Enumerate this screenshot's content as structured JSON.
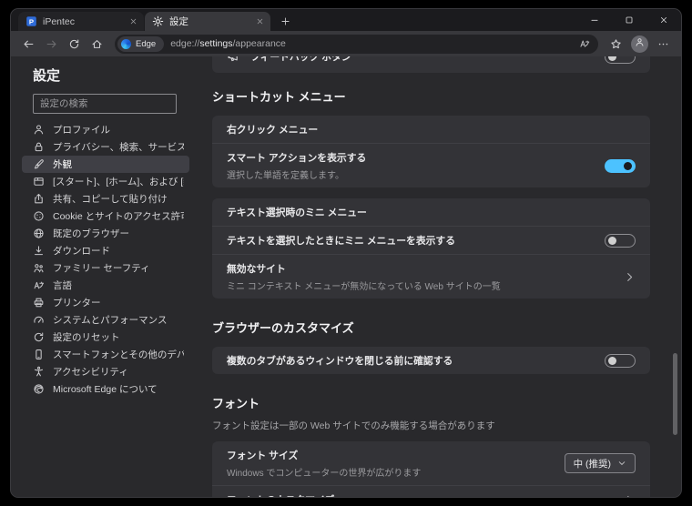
{
  "icons": {
    "back": "left-arrow",
    "forward": "right-arrow",
    "refresh": "circular-arrow",
    "home": "house",
    "translate": "translate-a",
    "star": "favorites-star",
    "ellipsis": "three-dots-menu",
    "person": "user-silhouette",
    "privacy": "padlock",
    "appearance": "paint-brush",
    "tabs": "browser-tabs",
    "share": "share-arrow",
    "cookie": "cookie",
    "globe": "globe",
    "download": "download-arrow",
    "family": "two-people",
    "language": "letter-a-kana",
    "printer": "printer",
    "performance": "speedometer",
    "reset": "circular-arrow",
    "phone": "smartphone",
    "accessibility": "accessibility-person",
    "edge": "edge-swirl",
    "feedback": "megaphone",
    "gear": "gear",
    "plus": "plus",
    "close": "x-cross",
    "minimize": "line",
    "maximize": "square",
    "chevdown": "chevron-down",
    "chevright": "chevron-right",
    "ipentec": "ipentec-logo"
  },
  "window": {
    "tabs": [
      {
        "title": "iPentec",
        "icon": "ipentec",
        "active": false
      },
      {
        "title": "設定",
        "icon": "gear",
        "active": true
      }
    ]
  },
  "navbar": {
    "badge": "Edge",
    "url_scheme": "edge://",
    "url_host": "settings",
    "url_path": "/appearance"
  },
  "sidebar": {
    "title": "設定",
    "search_placeholder": "設定の検索",
    "items": [
      {
        "label": "プロファイル",
        "icon": "person",
        "selected": false
      },
      {
        "label": "プライバシー、検索、サービス",
        "icon": "privacy",
        "selected": false
      },
      {
        "label": "外観",
        "icon": "appearance",
        "selected": true
      },
      {
        "label": "[スタート]、[ホーム]、および [新規] タブ",
        "icon": "tabs",
        "selected": false
      },
      {
        "label": "共有、コピーして貼り付け",
        "icon": "share",
        "selected": false
      },
      {
        "label": "Cookie とサイトのアクセス許可",
        "icon": "cookie",
        "selected": false
      },
      {
        "label": "既定のブラウザー",
        "icon": "globe",
        "selected": false
      },
      {
        "label": "ダウンロード",
        "icon": "download",
        "selected": false
      },
      {
        "label": "ファミリー セーフティ",
        "icon": "family",
        "selected": false
      },
      {
        "label": "言語",
        "icon": "language",
        "selected": false
      },
      {
        "label": "プリンター",
        "icon": "printer",
        "selected": false
      },
      {
        "label": "システムとパフォーマンス",
        "icon": "performance",
        "selected": false
      },
      {
        "label": "設定のリセット",
        "icon": "reset",
        "selected": false
      },
      {
        "label": "スマートフォンとその他のデバイス",
        "icon": "phone",
        "selected": false
      },
      {
        "label": "アクセシビリティ",
        "icon": "accessibility",
        "selected": false
      },
      {
        "label": "Microsoft Edge について",
        "icon": "edge",
        "selected": false
      }
    ]
  },
  "main": {
    "feedback_row": {
      "label": "フィードバック ボタン",
      "icon": "feedback",
      "enabled": false
    },
    "sections": [
      {
        "title": "ショートカット メニュー",
        "cards": [
          {
            "header": "右クリック メニュー",
            "rows": [
              {
                "title": "スマート アクションを表示する",
                "caption": "選択した単語を定義します。",
                "control": "toggle",
                "enabled": true
              }
            ]
          },
          {
            "header": "テキスト選択時のミニ メニュー",
            "rows": [
              {
                "title": "テキストを選択したときにミニ メニューを表示する",
                "control": "toggle",
                "enabled": false
              },
              {
                "title": "無効なサイト",
                "caption": "ミニ コンテキスト メニューが無効になっている Web サイトの一覧",
                "control": "link"
              }
            ]
          }
        ]
      },
      {
        "title": "ブラウザーのカスタマイズ",
        "cards": [
          {
            "rows": [
              {
                "title": "複数のタブがあるウィンドウを閉じる前に確認する",
                "control": "toggle",
                "enabled": false
              }
            ]
          }
        ]
      },
      {
        "title": "フォント",
        "caption": "フォント設定は一部の Web サイトでのみ機能する場合があります",
        "cards": [
          {
            "rows": [
              {
                "title": "フォント サイズ",
                "caption": "Windows でコンピューターの世界が広がります",
                "control": "dropdown",
                "value": "中 (推奨)"
              },
              {
                "title": "フォントのカスタマイズ",
                "control": "link"
              }
            ]
          }
        ]
      }
    ]
  }
}
